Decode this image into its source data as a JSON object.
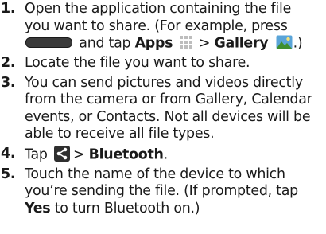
{
  "steps": [
    {
      "number": "1.",
      "line1": "Open the application containing the file",
      "line2": "you want to share. (For example, press",
      "line3_and_tap": "and tap",
      "apps_label": "Apps",
      "gt1": ">",
      "gallery_label": "Gallery",
      "close": ".)"
    },
    {
      "number": "2.",
      "text": "Locate the file you want to share."
    },
    {
      "number": "3.",
      "line1": "You can send pictures and videos directly",
      "line2": "from the camera or from Gallery, Calendar",
      "line3": "events, or Contacts. Not all devices will be",
      "line4": "able to receive all file types."
    },
    {
      "number": "4.",
      "tap": "Tap",
      "gt": ">",
      "bluetooth_label": "Bluetooth",
      "period": "."
    },
    {
      "number": "5.",
      "line1": "Touch the name of the device to which",
      "line2": "you’re sending the file. (If prompted, tap",
      "yes_label": "Yes",
      "line3_rest": "to turn Bluetooth on.)"
    }
  ],
  "icons": {
    "home_button": "home-button-icon",
    "apps": "apps-grid-icon",
    "gallery": "gallery-icon",
    "share": "share-icon"
  },
  "colors": {
    "text": "#1a1a1a",
    "icon_dark": "#2f2f2f",
    "gallery_green": "#3f8f2f"
  }
}
